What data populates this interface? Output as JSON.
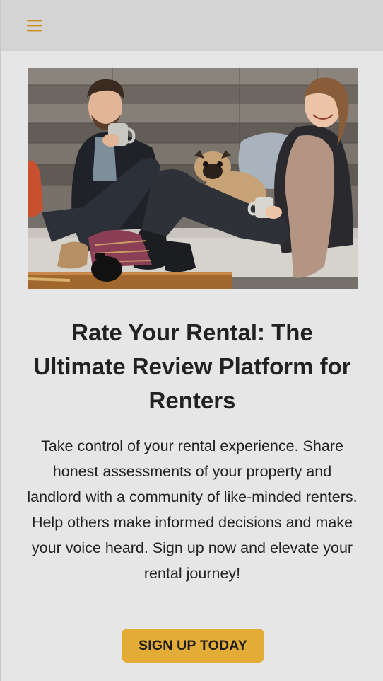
{
  "header": {
    "menu_icon": "hamburger-menu-icon",
    "accent_color": "#cf8a1e"
  },
  "hero": {
    "image_subject": "two people laughing on a couch with mugs and a pug"
  },
  "main": {
    "title": "Rate Your Rental: The Ultimate Review Platform for Renters",
    "description": "Take control of your rental experience. Share honest assessments of your property and landlord with a community of like-minded renters. Help others make informed decisions and make your voice heard. Sign up now and elevate your rental journey!",
    "cta_label": "SIGN UP TODAY"
  },
  "colors": {
    "background": "#e6e6e6",
    "topbar": "#d4d4d4",
    "button": "#e3ac37",
    "text": "#222222"
  }
}
